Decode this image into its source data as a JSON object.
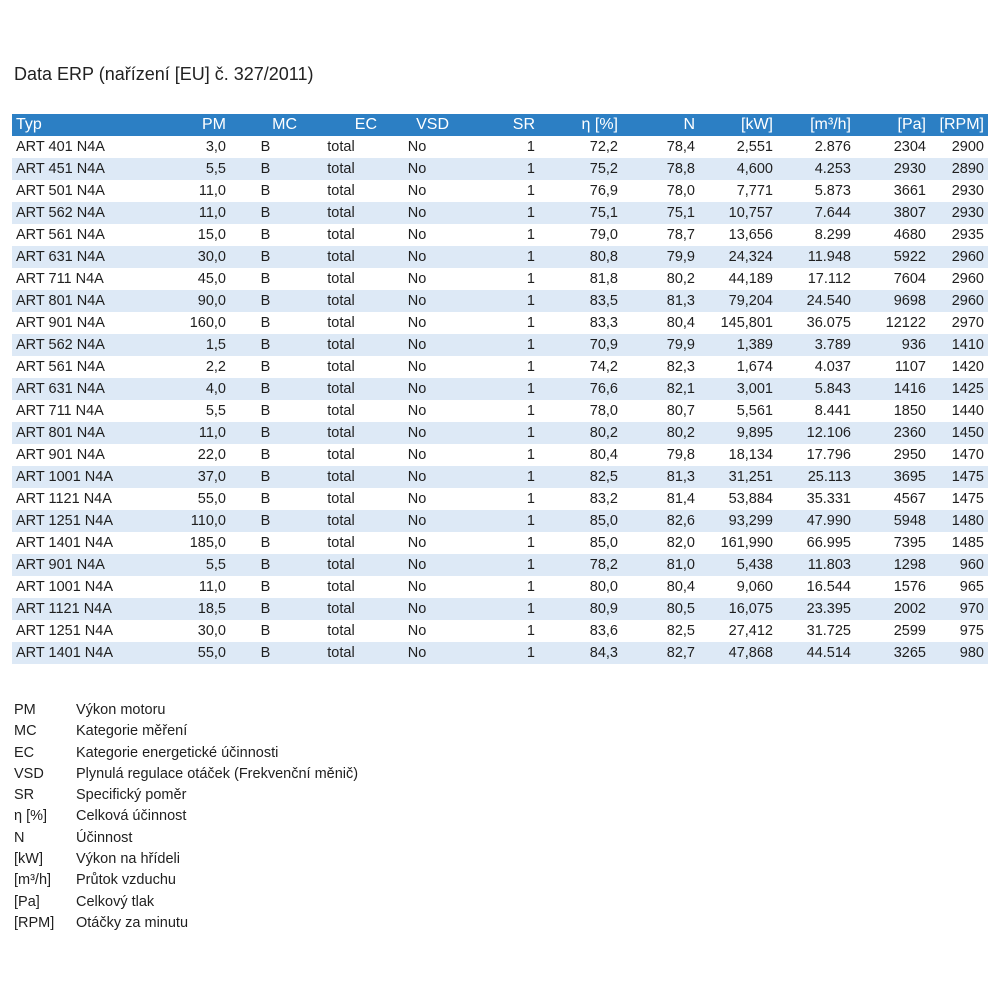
{
  "title": "Data ERP (nařízení [EU] č. 327/2011)",
  "table": {
    "headers": [
      "Typ",
      "PM",
      "MC",
      "EC",
      "VSD",
      "SR",
      "η [%]",
      "N",
      "[kW]",
      "[m³/h]",
      "[Pa]",
      "[RPM]"
    ],
    "rows": [
      [
        "ART 401 N4A",
        "3,0",
        "B",
        "total",
        "No",
        "1",
        "72,2",
        "78,4",
        "2,551",
        "2.876",
        "2304",
        "2900"
      ],
      [
        "ART 451 N4A",
        "5,5",
        "B",
        "total",
        "No",
        "1",
        "75,2",
        "78,8",
        "4,600",
        "4.253",
        "2930",
        "2890"
      ],
      [
        "ART 501 N4A",
        "11,0",
        "B",
        "total",
        "No",
        "1",
        "76,9",
        "78,0",
        "7,771",
        "5.873",
        "3661",
        "2930"
      ],
      [
        "ART 562 N4A",
        "11,0",
        "B",
        "total",
        "No",
        "1",
        "75,1",
        "75,1",
        "10,757",
        "7.644",
        "3807",
        "2930"
      ],
      [
        "ART 561 N4A",
        "15,0",
        "B",
        "total",
        "No",
        "1",
        "79,0",
        "78,7",
        "13,656",
        "8.299",
        "4680",
        "2935"
      ],
      [
        "ART 631 N4A",
        "30,0",
        "B",
        "total",
        "No",
        "1",
        "80,8",
        "79,9",
        "24,324",
        "11.948",
        "5922",
        "2960"
      ],
      [
        "ART 711 N4A",
        "45,0",
        "B",
        "total",
        "No",
        "1",
        "81,8",
        "80,2",
        "44,189",
        "17.112",
        "7604",
        "2960"
      ],
      [
        "ART 801 N4A",
        "90,0",
        "B",
        "total",
        "No",
        "1",
        "83,5",
        "81,3",
        "79,204",
        "24.540",
        "9698",
        "2960"
      ],
      [
        "ART 901 N4A",
        "160,0",
        "B",
        "total",
        "No",
        "1",
        "83,3",
        "80,4",
        "145,801",
        "36.075",
        "12122",
        "2970"
      ],
      [
        "ART 562 N4A",
        "1,5",
        "B",
        "total",
        "No",
        "1",
        "70,9",
        "79,9",
        "1,389",
        "3.789",
        "936",
        "1410"
      ],
      [
        "ART 561 N4A",
        "2,2",
        "B",
        "total",
        "No",
        "1",
        "74,2",
        "82,3",
        "1,674",
        "4.037",
        "1107",
        "1420"
      ],
      [
        "ART 631 N4A",
        "4,0",
        "B",
        "total",
        "No",
        "1",
        "76,6",
        "82,1",
        "3,001",
        "5.843",
        "1416",
        "1425"
      ],
      [
        "ART 711 N4A",
        "5,5",
        "B",
        "total",
        "No",
        "1",
        "78,0",
        "80,7",
        "5,561",
        "8.441",
        "1850",
        "1440"
      ],
      [
        "ART 801 N4A",
        "11,0",
        "B",
        "total",
        "No",
        "1",
        "80,2",
        "80,2",
        "9,895",
        "12.106",
        "2360",
        "1450"
      ],
      [
        "ART 901 N4A",
        "22,0",
        "B",
        "total",
        "No",
        "1",
        "80,4",
        "79,8",
        "18,134",
        "17.796",
        "2950",
        "1470"
      ],
      [
        "ART 1001 N4A",
        "37,0",
        "B",
        "total",
        "No",
        "1",
        "82,5",
        "81,3",
        "31,251",
        "25.113",
        "3695",
        "1475"
      ],
      [
        "ART 1121 N4A",
        "55,0",
        "B",
        "total",
        "No",
        "1",
        "83,2",
        "81,4",
        "53,884",
        "35.331",
        "4567",
        "1475"
      ],
      [
        "ART 1251 N4A",
        "110,0",
        "B",
        "total",
        "No",
        "1",
        "85,0",
        "82,6",
        "93,299",
        "47.990",
        "5948",
        "1480"
      ],
      [
        "ART 1401 N4A",
        "185,0",
        "B",
        "total",
        "No",
        "1",
        "85,0",
        "82,0",
        "161,990",
        "66.995",
        "7395",
        "1485"
      ],
      [
        "ART 901 N4A",
        "5,5",
        "B",
        "total",
        "No",
        "1",
        "78,2",
        "81,0",
        "5,438",
        "11.803",
        "1298",
        "960"
      ],
      [
        "ART 1001 N4A",
        "11,0",
        "B",
        "total",
        "No",
        "1",
        "80,0",
        "80,4",
        "9,060",
        "16.544",
        "1576",
        "965"
      ],
      [
        "ART 1121 N4A",
        "18,5",
        "B",
        "total",
        "No",
        "1",
        "80,9",
        "80,5",
        "16,075",
        "23.395",
        "2002",
        "970"
      ],
      [
        "ART 1251 N4A",
        "30,0",
        "B",
        "total",
        "No",
        "1",
        "83,6",
        "82,5",
        "27,412",
        "31.725",
        "2599",
        "975"
      ],
      [
        "ART 1401 N4A",
        "55,0",
        "B",
        "total",
        "No",
        "1",
        "84,3",
        "82,7",
        "47,868",
        "44.514",
        "3265",
        "980"
      ]
    ]
  },
  "legend": [
    {
      "abbr": "PM",
      "desc": "Výkon motoru"
    },
    {
      "abbr": "MC",
      "desc": "Kategorie měření"
    },
    {
      "abbr": "EC",
      "desc": "Kategorie energetické účinnosti"
    },
    {
      "abbr": "VSD",
      "desc": "Plynulá regulace otáček (Frekvenční měnič)"
    },
    {
      "abbr": "SR",
      "desc": "Specifický poměr"
    },
    {
      "abbr": "η [%]",
      "desc": "Celková účinnost"
    },
    {
      "abbr": "N",
      "desc": "Účinnost"
    },
    {
      "abbr": "[kW]",
      "desc": "Výkon na hřídeli"
    },
    {
      "abbr": "[m³/h]",
      "desc": "Průtok vzduchu"
    },
    {
      "abbr": "[Pa]",
      "desc": "Celkový tlak"
    },
    {
      "abbr": "[RPM]",
      "desc": "Otáčky za minutu"
    }
  ],
  "colors": {
    "header_bg": "#2c7fc4",
    "header_text": "#ffffff",
    "row_alt_bg": "#dde9f6"
  }
}
